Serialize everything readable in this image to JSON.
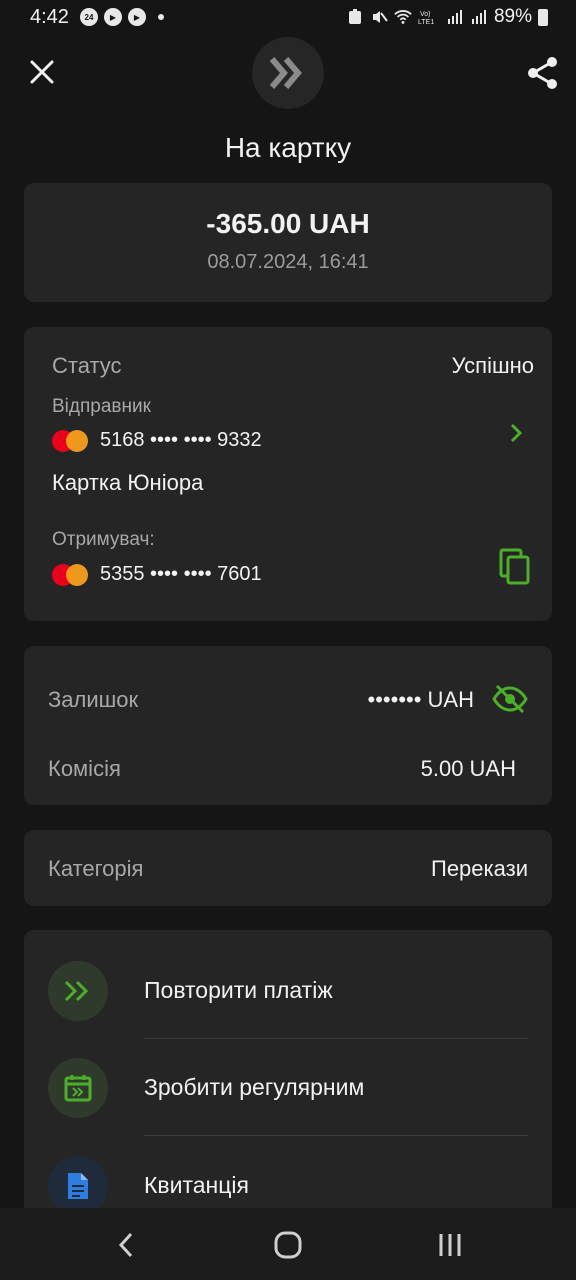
{
  "status_bar": {
    "time": "4:42",
    "badge": "24",
    "battery": "89%"
  },
  "header": {
    "title": "На картку",
    "close_icon": "close-icon",
    "logo_icon": "double-chevron-logo",
    "share_icon": "share-icon"
  },
  "summary": {
    "amount": "-365.00 UAH",
    "datetime": "08.07.2024, 16:41"
  },
  "details": {
    "status_label": "Статус",
    "status_value": "Успішно",
    "sender_label": "Відправник",
    "sender_card": "5168 •••• •••• 9332",
    "sender_card_name": "Картка Юніора",
    "recipient_label": "Отримувач:",
    "recipient_card": "5355 •••• •••• 7601"
  },
  "balance": {
    "balance_label": "Залишок",
    "balance_value": "••••••• UAH",
    "fee_label": "Комісія",
    "fee_value": "5.00 UAH"
  },
  "category": {
    "label": "Категорія",
    "value": "Перекази"
  },
  "actions": [
    {
      "label": "Повторити платіж",
      "icon": "repeat-payment-icon"
    },
    {
      "label": "Зробити регулярним",
      "icon": "calendar-icon"
    },
    {
      "label": "Квитанція",
      "icon": "receipt-icon"
    }
  ],
  "colors": {
    "accent_green": "#4caf2a",
    "background": "#151515",
    "card": "#252525",
    "receipt_blue": "#2f7de1"
  }
}
